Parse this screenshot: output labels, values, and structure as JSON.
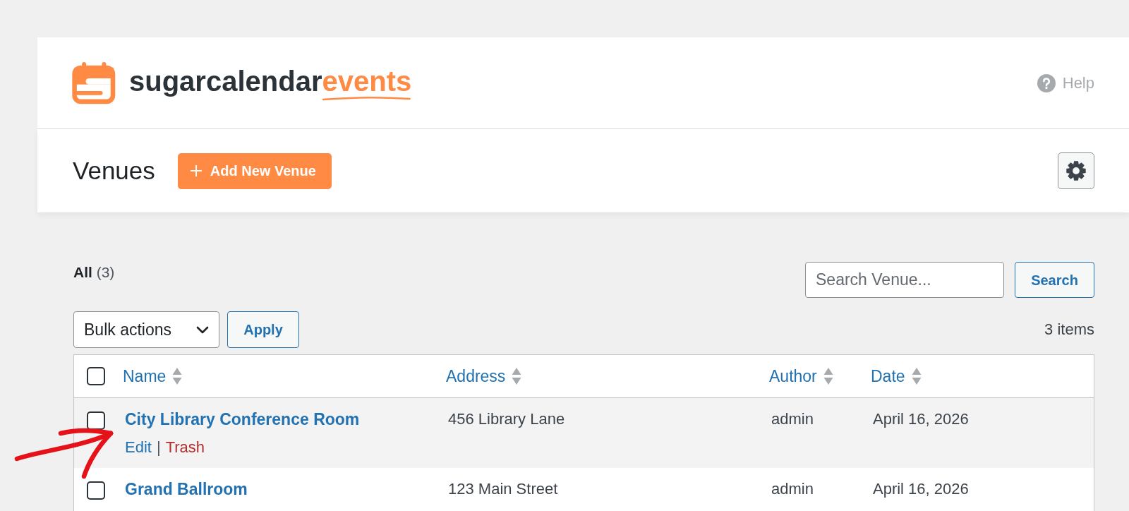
{
  "brand": {
    "name": "sugarcalendar",
    "suffix": "events",
    "help": "Help"
  },
  "page_header": {
    "title": "Venues",
    "add_button": "Add New Venue"
  },
  "views": [
    {
      "label": "All",
      "count": "(3)",
      "selected": true
    }
  ],
  "search": {
    "placeholder": "Search Venue...",
    "button": "Search"
  },
  "bulk_actions": {
    "value": "Bulk actions",
    "apply": "Apply"
  },
  "item_count": "3 items",
  "table": {
    "select_all": {
      "checked": false
    },
    "columns": [
      {
        "label": "Name",
        "sortable": true
      },
      {
        "label": "Address",
        "sortable": true
      },
      {
        "label": "Author",
        "sortable": true
      },
      {
        "label": "Date",
        "sortable": true
      }
    ],
    "rows": [
      {
        "checked": false,
        "hovered": true,
        "name": "City Library Conference Room",
        "actions": [
          {
            "label": "Edit",
            "kind": "edit"
          },
          {
            "label": "Trash",
            "kind": "trash"
          }
        ],
        "action_separator": "|",
        "address": "456 Library Lane",
        "author": "admin",
        "date": "April 16, 2026"
      },
      {
        "checked": false,
        "hovered": false,
        "name": "Grand Ballroom",
        "address": "123 Main Street",
        "author": "admin",
        "date": "April 16, 2026"
      }
    ]
  },
  "annotations": [
    {
      "kind": "arrow"
    }
  ]
}
